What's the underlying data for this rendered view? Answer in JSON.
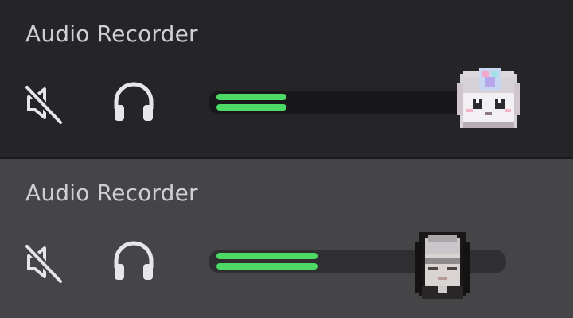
{
  "panels": [
    {
      "title": "Audio Recorder",
      "mic_state": "muted",
      "level": 0.26,
      "avatar": "pixel-cat-avatar",
      "colors": {
        "background": "#252528",
        "meter_fill": "#4cd964"
      }
    },
    {
      "title": "Audio Recorder",
      "mic_state": "muted",
      "level": 0.36,
      "avatar": "pixel-person-avatar",
      "colors": {
        "background": "#454548",
        "meter_fill": "#4cd964"
      }
    }
  ],
  "icons": {
    "mute": "speaker-muted-icon",
    "headphones": "headphones-icon"
  }
}
